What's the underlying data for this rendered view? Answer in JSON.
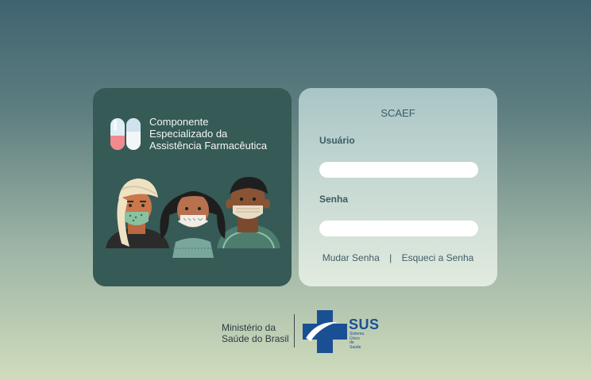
{
  "brand": {
    "line1": "Componente",
    "line2": "Especializado da",
    "line3": "Assistência Farmacêutica"
  },
  "login": {
    "system_title": "SCAEF",
    "username_label": "Usuário",
    "username_value": "",
    "password_label": "Senha",
    "password_value": "",
    "change_password_link": "Mudar Senha",
    "separator": "|",
    "forgot_password_link": "Esqueci a Senha"
  },
  "footer": {
    "ministry_line1": "Ministério da",
    "ministry_line2": "Saúde do Brasil",
    "sus_title": "SUS",
    "sus_line1": "Sistema",
    "sus_line2": "Único",
    "sus_line3": "de Saúde"
  },
  "colors": {
    "card_dark": "#365a56",
    "sus_blue": "#1a4f93",
    "pill_pink": "#f08a8f",
    "pill_blue": "#cfe3ee"
  },
  "icons": [
    "pill-logo-icon",
    "people-masks-illustration",
    "sus-cross-icon"
  ]
}
